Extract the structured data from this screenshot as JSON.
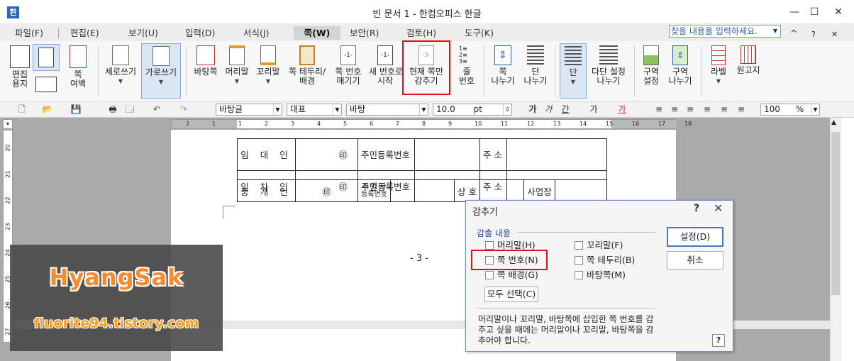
{
  "window": {
    "title": "빈 문서 1 - 한컴오피스 한글",
    "app_icon": "한",
    "min": "—",
    "max": "☐",
    "close": "✕"
  },
  "menu": {
    "items": [
      "파일(F)",
      "편집(E)",
      "보기(U)",
      "입력(D)",
      "서식(J)",
      "쪽(W)",
      "보안(R)",
      "검토(H)",
      "도구(K)"
    ],
    "search_placeholder": "찾을 내용을 입력하세요.",
    "right_icons": [
      "^",
      "?",
      "✕"
    ]
  },
  "ribbon": {
    "edit_paper": "편집\n용지",
    "page_margin": "쪽\n여백",
    "vertical_write": "세로쓰기",
    "horizontal_write": "가로쓰기",
    "background": "바탕쪽",
    "header": "머리말",
    "footer": "꼬리말",
    "page_border": "쪽 테두리/\n배경",
    "page_number": "쪽 번호\n매기기",
    "new_number": "새 번호로\n시작",
    "hide_current": "현재 쪽만\n감추기",
    "line_number": "줄\n번호",
    "page_break": "쪽\n나누기",
    "column_break": "단\n나누기",
    "column": "단",
    "multi_column": "다단 설정\n나누기",
    "section_set": "구역\n설정",
    "section_break": "구역\n나누기",
    "label": "라벨",
    "manuscript": "원고지"
  },
  "toolbar": {
    "style": "바탕글",
    "lang": "대표",
    "font": "바탕",
    "size": "10.0",
    "size_unit": "pt",
    "zoom": "100",
    "zoom_unit": "%",
    "fmt_bold": "가",
    "fmt_italic": "가",
    "fmt_underline": "간",
    "fmt_strike": "가",
    "fmt_color": "가"
  },
  "ruler": {
    "h_ticks": [
      "2",
      "1",
      "1",
      "2",
      "3",
      "4",
      "5",
      "6",
      "7",
      "8",
      "9",
      "10",
      "11",
      "12",
      "13",
      "14",
      "15",
      "16",
      "17",
      "18"
    ],
    "v_ticks": [
      "20",
      "21",
      "22",
      "23",
      "24",
      "25",
      "26",
      "27"
    ]
  },
  "doc_table": {
    "rows": [
      {
        "label": "임 대 인",
        "seal": "㊞",
        "reg": "주민등록번호",
        "addr": "주 소"
      },
      {
        "label": "임 차 인",
        "seal": "㊞",
        "reg": "주민등록번호",
        "addr": "주 소"
      },
      {
        "label": "중 개 인",
        "seal": "㊞",
        "reg": "사 업 자\n등록번호",
        "addr": "상 호",
        "extra": "사업장"
      }
    ]
  },
  "page_number_text": "- 3 -",
  "watermark": {
    "name": "HyangSak",
    "url": "fluorite94.tistory.com"
  },
  "dialog": {
    "title": "감추기",
    "help": "?",
    "close": "✕",
    "group_label": "감출 내용",
    "options": {
      "header": "머리말(H)",
      "footer": "꼬리말(F)",
      "page_number": "쪽 번호(N)",
      "page_border": "쪽 테두리(B)",
      "page_bg": "쪽 배경(G)",
      "master_page": "바탕쪽(M)"
    },
    "select_all": "모두 선택(C)",
    "ok": "설정(D)",
    "cancel": "취소",
    "description": "머리말이나 꼬리말, 바탕쪽에 삽입한 쪽 번호를 감추고 싶을 때에는 머리말이나 꼬리말, 바탕쪽을 감추어야 합니다.",
    "q_icon": "?"
  },
  "colors": {
    "highlight": "#e0101a",
    "dialog_border": "#6f8fc8",
    "watermark_orange": "#ff8a2a"
  }
}
